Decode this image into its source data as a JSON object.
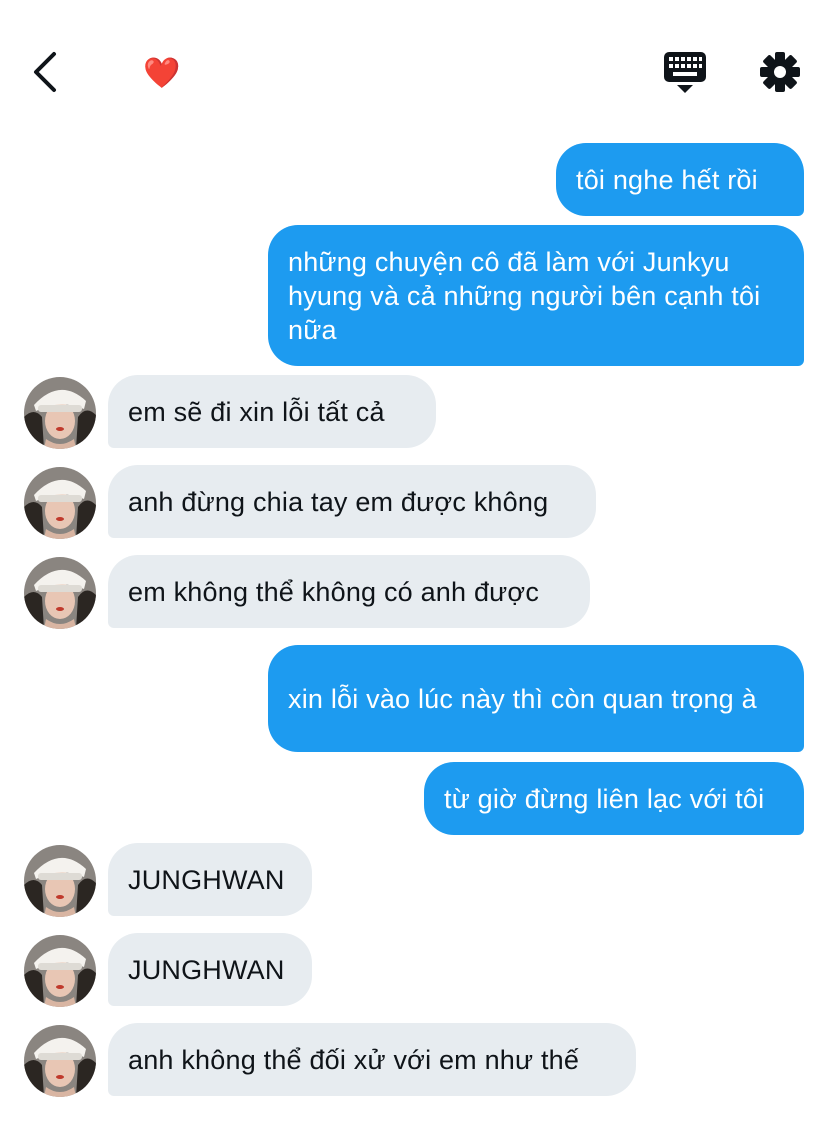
{
  "header": {
    "back_icon": "chevron-left-icon",
    "heart": "❤️",
    "keyboard_icon": "keyboard-icon",
    "settings_icon": "gear-icon"
  },
  "colors": {
    "outgoing": "#1d9bf0",
    "incoming": "#e7ecf0",
    "text": "#0f1419"
  },
  "messages": [
    {
      "side": "out",
      "text": "tôi nghe hết rồi"
    },
    {
      "side": "out",
      "text": "những chuyện cô đã làm với Junkyu hyung và cả những người bên cạnh tôi nữa"
    },
    {
      "side": "in",
      "text": "em sẽ đi xin lỗi tất cả"
    },
    {
      "side": "in",
      "text": "anh đừng chia tay em được không"
    },
    {
      "side": "in",
      "text": "em không thể không có anh được"
    },
    {
      "side": "out",
      "text": "xin lỗi vào lúc này thì còn quan trọng à"
    },
    {
      "side": "out",
      "text": "từ giờ đừng liên lạc với tôi"
    },
    {
      "side": "in",
      "text": "JUNGHWAN"
    },
    {
      "side": "in",
      "text": "JUNGHWAN"
    },
    {
      "side": "in",
      "text": "anh không thể đối xử với em như thế"
    }
  ]
}
